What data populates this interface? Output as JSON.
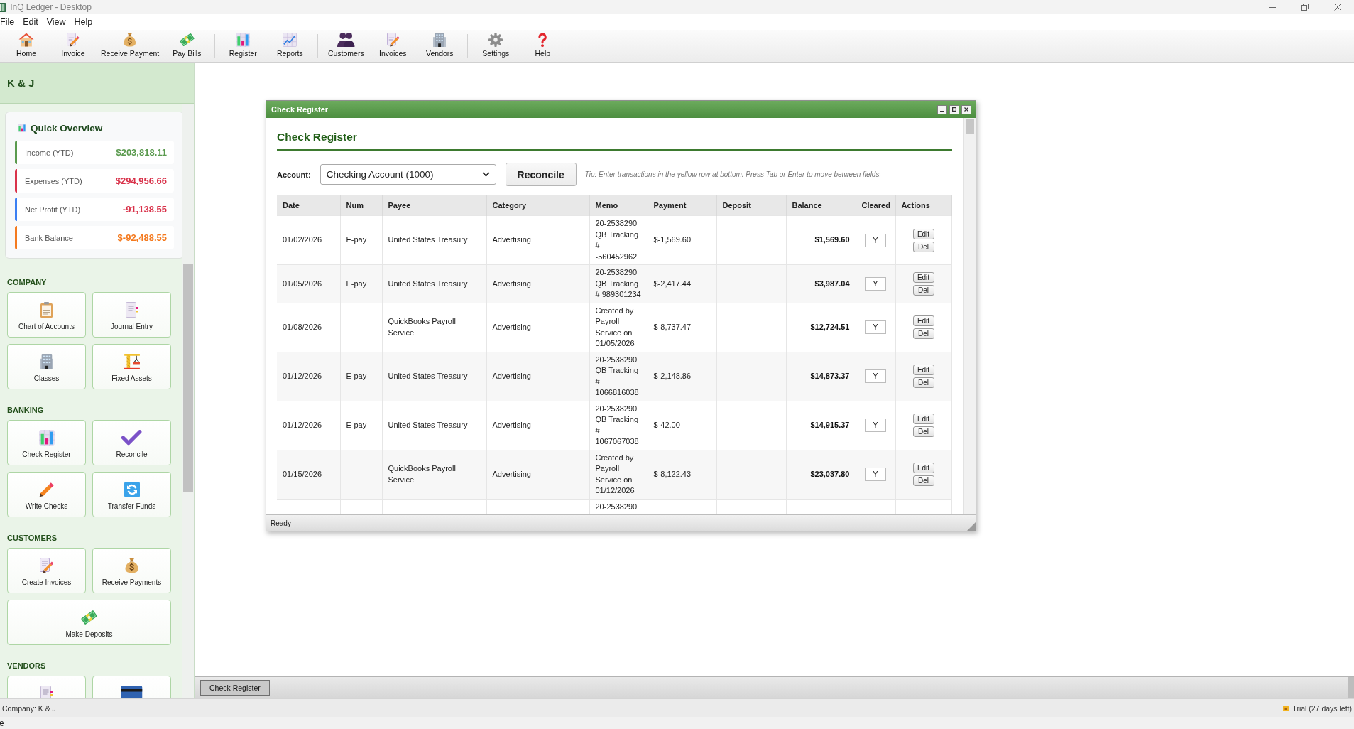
{
  "window": {
    "title": "InQ Ledger - Desktop"
  },
  "menu": [
    {
      "label": "File"
    },
    {
      "label": "Edit"
    },
    {
      "label": "View"
    },
    {
      "label": "Help"
    }
  ],
  "toolbar": {
    "groups": [
      {
        "items": [
          {
            "label": "Home"
          },
          {
            "label": "Invoice"
          },
          {
            "label": "Receive Payment"
          },
          {
            "label": "Pay Bills"
          }
        ]
      },
      {
        "items": [
          {
            "label": "Register"
          },
          {
            "label": "Reports"
          }
        ]
      },
      {
        "items": [
          {
            "label": "Customers"
          },
          {
            "label": "Invoices"
          },
          {
            "label": "Vendors"
          }
        ]
      },
      {
        "items": [
          {
            "label": "Settings"
          },
          {
            "label": "Help"
          }
        ]
      }
    ]
  },
  "sidebar": {
    "company_name": "K & J",
    "overview": {
      "title": "Quick Overview",
      "metrics": [
        {
          "label": "Income (YTD)",
          "color": "#5a9a4e",
          "value": {
            "text": "$203,818.11",
            "color": "#5a9a4e"
          }
        },
        {
          "label": "Expenses (YTD)",
          "color": "#d9324a",
          "value": {
            "text": "$294,956.66",
            "color": "#d9324a"
          }
        },
        {
          "label": "Net Profit (YTD)",
          "color": "#3b7ff2",
          "value": {
            "text": "-91,138.55",
            "color": "#d9324a"
          }
        },
        {
          "label": "Bank Balance",
          "color": "#f47a1f",
          "value": {
            "text": "$-92,488.55",
            "color": "#f47a1f"
          }
        }
      ]
    },
    "sections": [
      {
        "title": "COMPANY",
        "tiles": [
          {
            "label": "Chart of Accounts",
            "wide": false
          },
          {
            "label": "Journal Entry",
            "wide": false
          },
          {
            "label": "Classes",
            "wide": false
          },
          {
            "label": "Fixed Assets",
            "wide": false
          }
        ]
      },
      {
        "title": "BANKING",
        "tiles": [
          {
            "label": "Check Register",
            "wide": false
          },
          {
            "label": "Reconcile",
            "wide": false
          },
          {
            "label": "Write Checks",
            "wide": false
          },
          {
            "label": "Transfer Funds",
            "wide": false
          }
        ]
      },
      {
        "title": "CUSTOMERS",
        "tiles": [
          {
            "label": "Create Invoices",
            "wide": false
          },
          {
            "label": "Receive Payments",
            "wide": false
          },
          {
            "label": "Make Deposits",
            "wide": true
          }
        ]
      },
      {
        "title": "VENDORS",
        "tiles": [
          {
            "wide": false
          },
          {
            "wide": false
          }
        ]
      }
    ]
  },
  "register_window": {
    "title": "Check Register",
    "heading": "Check Register",
    "account_label": "Account:",
    "account": "Checking Account (1000)",
    "reconcile_button": "Reconcile",
    "tip": "Tip: Enter transactions in the yellow row at bottom. Press Tab or Enter to move between fields.",
    "table": {
      "columns": [
        "Date",
        "Num",
        "Payee",
        "Category",
        "Memo",
        "Payment",
        "Deposit",
        "Balance",
        "Cleared",
        "Actions"
      ],
      "rows": [
        {
          "date": "01/02/2026",
          "num": "E-pay",
          "payee": "United States Treasury",
          "category": "Advertising",
          "memo": "20-2538290 QB Tracking # -560452962",
          "payment": "$-1,569.60",
          "balance": "$1,569.60",
          "cleared": "Y",
          "actions": [
            "Edit",
            "Del"
          ]
        },
        {
          "date": "01/05/2026",
          "num": "E-pay",
          "payee": "United States Treasury",
          "category": "Advertising",
          "memo": "20-2538290 QB Tracking # 989301234",
          "payment": "$-2,417.44",
          "balance": "$3,987.04",
          "cleared": "Y",
          "actions": [
            "Edit",
            "Del"
          ]
        },
        {
          "date": "01/08/2026",
          "payee": "QuickBooks Payroll Service",
          "category": "Advertising",
          "memo": "Created by Payroll Service on 01/05/2026",
          "payment": "$-8,737.47",
          "balance": "$12,724.51",
          "cleared": "Y",
          "actions": [
            "Edit",
            "Del"
          ]
        },
        {
          "date": "01/12/2026",
          "num": "E-pay",
          "payee": "United States Treasury",
          "category": "Advertising",
          "memo": "20-2538290 QB Tracking # 1066816038",
          "payment": "$-2,148.86",
          "balance": "$14,873.37",
          "cleared": "Y",
          "actions": [
            "Edit",
            "Del"
          ]
        },
        {
          "date": "01/12/2026",
          "num": "E-pay",
          "payee": "United States Treasury",
          "category": "Advertising",
          "memo": "20-2538290 QB Tracking # 1067067038",
          "payment": "$-42.00",
          "balance": "$14,915.37",
          "cleared": "Y",
          "actions": [
            "Edit",
            "Del"
          ]
        },
        {
          "date": "01/15/2026",
          "payee": "QuickBooks Payroll Service",
          "category": "Advertising",
          "memo": "Created by Payroll Service on 01/12/2026",
          "payment": "$-8,122.43",
          "balance": "$23,037.80",
          "cleared": "Y",
          "actions": [
            "Edit",
            "Del"
          ]
        },
        {
          "memo": "20-2538290"
        }
      ]
    },
    "status": "Ready"
  },
  "taskbar": {
    "items": [
      {
        "label": "Check Register"
      }
    ]
  },
  "status_bar": {
    "company": "Company: K & J",
    "trial": "Trial (27 days left)"
  },
  "footer": {
    "text": "e"
  }
}
